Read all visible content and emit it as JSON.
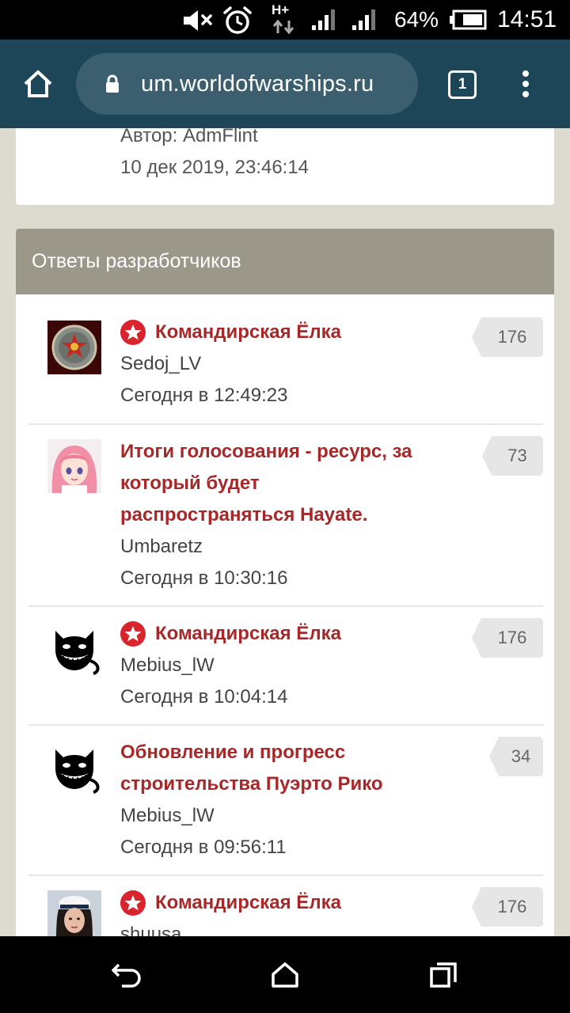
{
  "status_bar": {
    "network": "H+",
    "battery": "64%",
    "time": "14:51",
    "icons": [
      "mute-icon",
      "alarm-icon",
      "data-arrows-icon",
      "signal-icon",
      "signal-icon",
      "battery-icon"
    ]
  },
  "browser": {
    "url": "um.worldofwarships.ru",
    "tab_count": "1",
    "icons": [
      "home-icon",
      "lock-icon",
      "menu-dots-icon"
    ]
  },
  "top_card": {
    "author": "Автор: AdmFlint",
    "date": "10 дек 2019, 23:46:14"
  },
  "dev_section": {
    "header": "Ответы разработчиков",
    "items": [
      {
        "title": "Командирская Ёлка",
        "author": "Sedoj_LV",
        "time": "Сегодня в 12:49:23",
        "count": "176",
        "pinned": true,
        "avatar": "emblem"
      },
      {
        "title_lines": [
          "Итоги голосования - ресурс, за",
          "который будет",
          "распространяться Hayate."
        ],
        "author": "Umbaretz",
        "time": "Сегодня в 10:30:16",
        "count": "73",
        "pinned": false,
        "avatar": "anime-girl"
      },
      {
        "title": "Командирская Ёлка",
        "author": "Mebius_lW",
        "time": "Сегодня в 10:04:14",
        "count": "176",
        "pinned": true,
        "avatar": "black-cat"
      },
      {
        "title_lines": [
          "Обновление и прогресс",
          "строительства Пуэрто Рико"
        ],
        "author": "Mebius_lW",
        "time": "Сегодня в 09:56:11",
        "count": "34",
        "pinned": false,
        "avatar": "black-cat"
      },
      {
        "title": "Командирская Ёлка",
        "author": "shuusa",
        "count": "176",
        "pinned": true,
        "avatar": "woman-photo"
      }
    ]
  },
  "nav_bar": {
    "icons": [
      "back-icon",
      "home-nav-icon",
      "recents-icon"
    ]
  },
  "colors": {
    "toolbar": "#1e4659",
    "url_pill": "#3b5f6f",
    "header": "#9b988a",
    "title": "#a62828",
    "badge_red": "#d9232d"
  }
}
